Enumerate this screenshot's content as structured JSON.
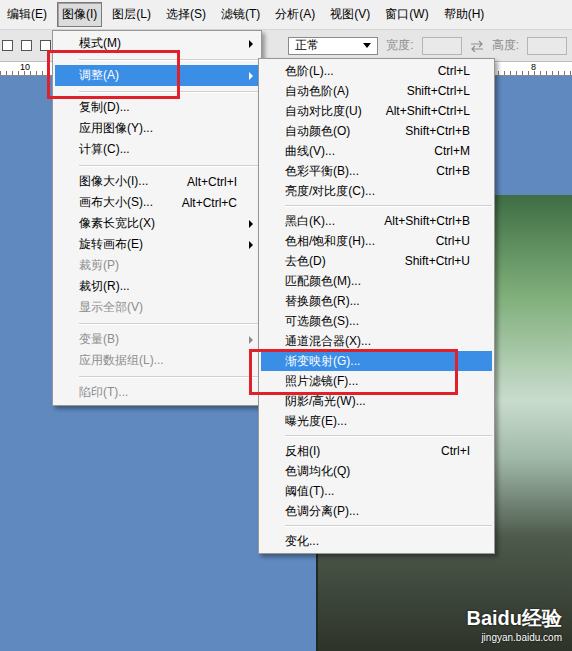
{
  "menubar": [
    {
      "label": "编辑(E)",
      "selected": false
    },
    {
      "label": "图像(I)",
      "selected": true
    },
    {
      "label": "图层(L)",
      "selected": false
    },
    {
      "label": "选择(S)",
      "selected": false
    },
    {
      "label": "滤镜(T)",
      "selected": false
    },
    {
      "label": "分析(A)",
      "selected": false
    },
    {
      "label": "视图(V)",
      "selected": false
    },
    {
      "label": "窗口(W)",
      "selected": false
    },
    {
      "label": "帮助(H)",
      "selected": false
    }
  ],
  "options_bar": {
    "mode": "正常",
    "width_label": "宽度:",
    "height_label": "高度:",
    "width_disabled": true,
    "height_disabled": true
  },
  "ruler": {
    "labels": [
      "10",
      "8"
    ]
  },
  "image_menu": [
    {
      "kind": "item",
      "label": "模式(M)",
      "shortcut": "",
      "submenu": true,
      "disabled": false,
      "selected": false
    },
    {
      "kind": "separator"
    },
    {
      "kind": "item",
      "label": "调整(A)",
      "shortcut": "",
      "submenu": true,
      "disabled": false,
      "selected": true
    },
    {
      "kind": "separator"
    },
    {
      "kind": "item",
      "label": "复制(D)...",
      "shortcut": "",
      "submenu": false,
      "disabled": false,
      "selected": false
    },
    {
      "kind": "item",
      "label": "应用图像(Y)...",
      "shortcut": "",
      "submenu": false,
      "disabled": false,
      "selected": false
    },
    {
      "kind": "item",
      "label": "计算(C)...",
      "shortcut": "",
      "submenu": false,
      "disabled": false,
      "selected": false
    },
    {
      "kind": "separator"
    },
    {
      "kind": "item",
      "label": "图像大小(I)...",
      "shortcut": "Alt+Ctrl+I",
      "submenu": false,
      "disabled": false,
      "selected": false
    },
    {
      "kind": "item",
      "label": "画布大小(S)...",
      "shortcut": "Alt+Ctrl+C",
      "submenu": false,
      "disabled": false,
      "selected": false
    },
    {
      "kind": "item",
      "label": "像素长宽比(X)",
      "shortcut": "",
      "submenu": true,
      "disabled": false,
      "selected": false
    },
    {
      "kind": "item",
      "label": "旋转画布(E)",
      "shortcut": "",
      "submenu": true,
      "disabled": false,
      "selected": false
    },
    {
      "kind": "item",
      "label": "裁剪(P)",
      "shortcut": "",
      "submenu": false,
      "disabled": true,
      "selected": false
    },
    {
      "kind": "item",
      "label": "裁切(R)...",
      "shortcut": "",
      "submenu": false,
      "disabled": false,
      "selected": false
    },
    {
      "kind": "item",
      "label": "显示全部(V)",
      "shortcut": "",
      "submenu": false,
      "disabled": true,
      "selected": false
    },
    {
      "kind": "separator"
    },
    {
      "kind": "item",
      "label": "变量(B)",
      "shortcut": "",
      "submenu": true,
      "disabled": true,
      "selected": false
    },
    {
      "kind": "item",
      "label": "应用数据组(L)...",
      "shortcut": "",
      "submenu": false,
      "disabled": true,
      "selected": false
    },
    {
      "kind": "separator"
    },
    {
      "kind": "item",
      "label": "陷印(T)...",
      "shortcut": "",
      "submenu": false,
      "disabled": true,
      "selected": false
    }
  ],
  "adjust_submenu": [
    {
      "kind": "item",
      "label": "色阶(L)...",
      "shortcut": "Ctrl+L",
      "submenu": false,
      "disabled": false,
      "selected": false
    },
    {
      "kind": "item",
      "label": "自动色阶(A)",
      "shortcut": "Shift+Ctrl+L",
      "submenu": false,
      "disabled": false,
      "selected": false
    },
    {
      "kind": "item",
      "label": "自动对比度(U)",
      "shortcut": "Alt+Shift+Ctrl+L",
      "submenu": false,
      "disabled": false,
      "selected": false
    },
    {
      "kind": "item",
      "label": "自动颜色(O)",
      "shortcut": "Shift+Ctrl+B",
      "submenu": false,
      "disabled": false,
      "selected": false
    },
    {
      "kind": "item",
      "label": "曲线(V)...",
      "shortcut": "Ctrl+M",
      "submenu": false,
      "disabled": false,
      "selected": false
    },
    {
      "kind": "item",
      "label": "色彩平衡(B)...",
      "shortcut": "Ctrl+B",
      "submenu": false,
      "disabled": false,
      "selected": false
    },
    {
      "kind": "item",
      "label": "亮度/对比度(C)...",
      "shortcut": "",
      "submenu": false,
      "disabled": false,
      "selected": false
    },
    {
      "kind": "separator"
    },
    {
      "kind": "item",
      "label": "黑白(K)...",
      "shortcut": "Alt+Shift+Ctrl+B",
      "submenu": false,
      "disabled": false,
      "selected": false
    },
    {
      "kind": "item",
      "label": "色相/饱和度(H)...",
      "shortcut": "Ctrl+U",
      "submenu": false,
      "disabled": false,
      "selected": false
    },
    {
      "kind": "item",
      "label": "去色(D)",
      "shortcut": "Shift+Ctrl+U",
      "submenu": false,
      "disabled": false,
      "selected": false
    },
    {
      "kind": "item",
      "label": "匹配颜色(M)...",
      "shortcut": "",
      "submenu": false,
      "disabled": false,
      "selected": false
    },
    {
      "kind": "item",
      "label": "替换颜色(R)...",
      "shortcut": "",
      "submenu": false,
      "disabled": false,
      "selected": false
    },
    {
      "kind": "item",
      "label": "可选颜色(S)...",
      "shortcut": "",
      "submenu": false,
      "disabled": false,
      "selected": false
    },
    {
      "kind": "item",
      "label": "通道混合器(X)...",
      "shortcut": "",
      "submenu": false,
      "disabled": false,
      "selected": false
    },
    {
      "kind": "item",
      "label": "渐变映射(G)...",
      "shortcut": "",
      "submenu": false,
      "disabled": false,
      "selected": true
    },
    {
      "kind": "item",
      "label": "照片滤镜(F)...",
      "shortcut": "",
      "submenu": false,
      "disabled": false,
      "selected": false
    },
    {
      "kind": "item",
      "label": "阴影/高光(W)...",
      "shortcut": "",
      "submenu": false,
      "disabled": false,
      "selected": false
    },
    {
      "kind": "item",
      "label": "曝光度(E)...",
      "shortcut": "",
      "submenu": false,
      "disabled": false,
      "selected": false
    },
    {
      "kind": "separator"
    },
    {
      "kind": "item",
      "label": "反相(I)",
      "shortcut": "Ctrl+I",
      "submenu": false,
      "disabled": false,
      "selected": false
    },
    {
      "kind": "item",
      "label": "色调均化(Q)",
      "shortcut": "",
      "submenu": false,
      "disabled": false,
      "selected": false
    },
    {
      "kind": "item",
      "label": "阈值(T)...",
      "shortcut": "",
      "submenu": false,
      "disabled": false,
      "selected": false
    },
    {
      "kind": "item",
      "label": "色调分离(P)...",
      "shortcut": "",
      "submenu": false,
      "disabled": false,
      "selected": false
    },
    {
      "kind": "separator"
    },
    {
      "kind": "item",
      "label": "变化...",
      "shortcut": "",
      "submenu": false,
      "disabled": false,
      "selected": false
    }
  ],
  "watermark": {
    "logo": "Baidu经验",
    "url": "jingyan.baidu.com"
  }
}
